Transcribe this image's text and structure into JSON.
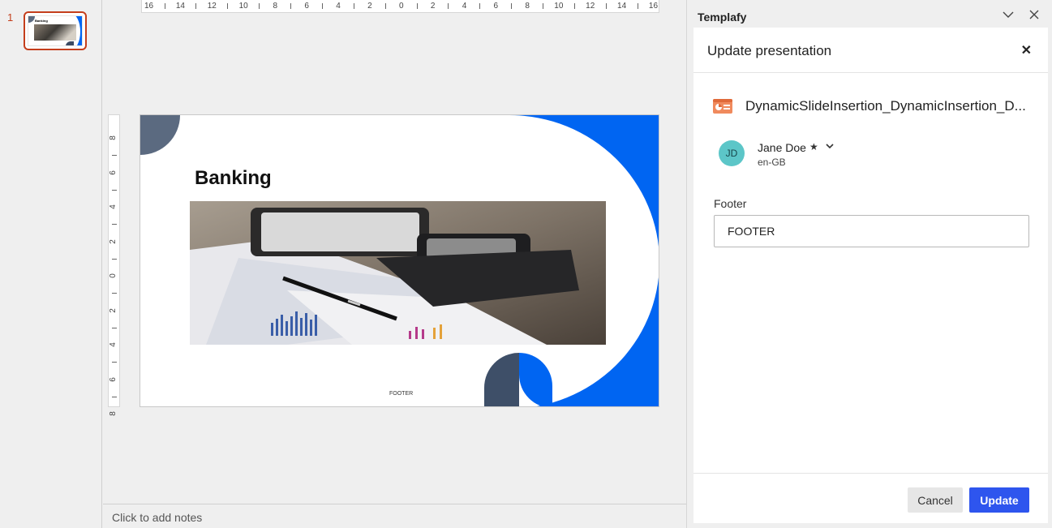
{
  "thumbnails": {
    "slide_number": "1",
    "title_text": "Banking"
  },
  "ruler": {
    "horizontal": [
      "16",
      "14",
      "12",
      "10",
      "8",
      "6",
      "4",
      "2",
      "0",
      "2",
      "4",
      "6",
      "8",
      "10",
      "12",
      "14",
      "16"
    ],
    "vertical": [
      "8",
      "6",
      "4",
      "2",
      "0",
      "2",
      "4",
      "6",
      "8"
    ]
  },
  "slide": {
    "title": "Banking",
    "footer": "FOOTER"
  },
  "notes": {
    "placeholder": "Click to add notes"
  },
  "panel": {
    "title": "Templafy",
    "card": {
      "title": "Update presentation",
      "file_name": "DynamicSlideInsertion_DynamicInsertion_D...",
      "user": {
        "initials": "JD",
        "name": "Jane Doe",
        "star": "★",
        "locale": "en-GB"
      },
      "footer_field": {
        "label": "Footer",
        "value": "FOOTER"
      },
      "cancel_label": "Cancel",
      "update_label": "Update"
    }
  },
  "colors": {
    "accent_blue": "#0065f2",
    "brand_dark": "#3e4f68",
    "update_button": "#2e55ee",
    "selection": "#c43e1c"
  }
}
